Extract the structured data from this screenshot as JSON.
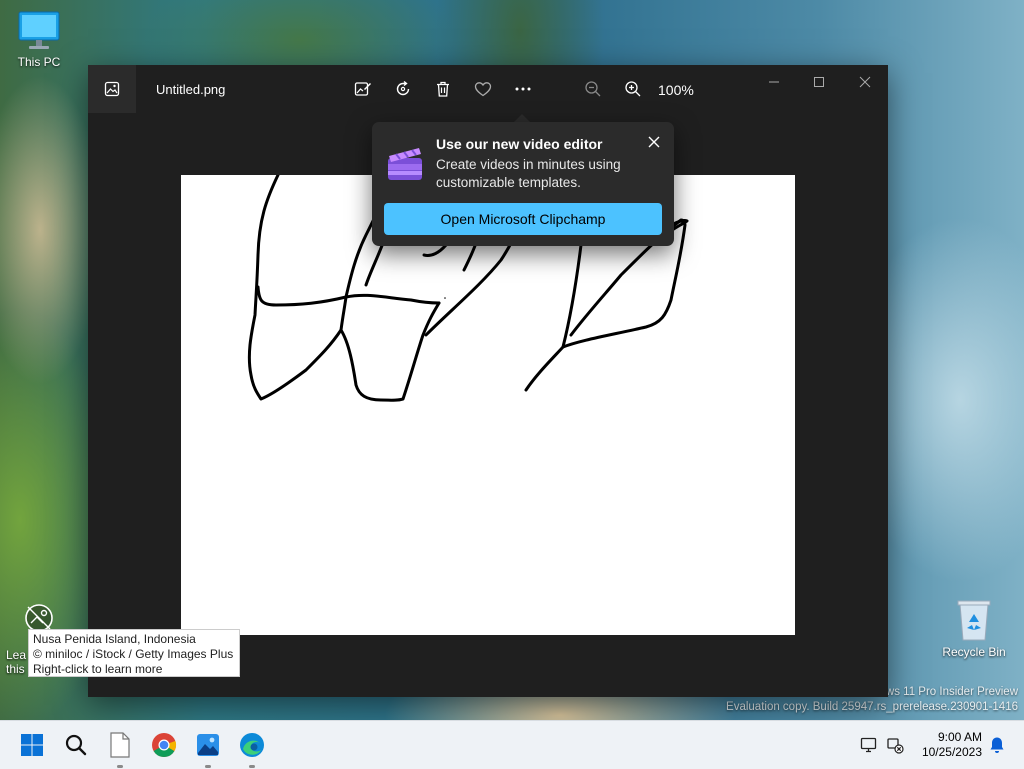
{
  "desktop": {
    "icons": {
      "this_pc": "This PC",
      "recycle_bin": "Recycle Bin"
    },
    "spotlight_label": "Lea\nthis",
    "watermark": {
      "line1": "ws 11 Pro Insider Preview",
      "line2": "Evaluation copy. Build 25947.rs_prerelease.230901-1416"
    }
  },
  "photos_window": {
    "filename": "Untitled.png",
    "zoom": "100%",
    "toolbar": [
      "edit-image-icon",
      "rotate-icon",
      "delete-icon",
      "favorite-icon",
      "more-icon",
      "zoom-out-icon",
      "zoom-in-icon"
    ],
    "window_controls": [
      "minimize-icon",
      "maximize-icon",
      "close-icon"
    ]
  },
  "teaching_tip": {
    "title": "Use our new video editor",
    "body": "Create videos in minutes using customizable templates.",
    "button": "Open Microsoft Clipchamp",
    "accent": "#4cc2ff"
  },
  "spotlight_tooltip": {
    "line1": "Nusa Penida Island, Indonesia",
    "line2": "© miniloc / iStock / Getty Images Plus",
    "line3": "Right-click to learn more"
  },
  "taskbar": {
    "apps": [
      "start-icon",
      "search-icon",
      "notepad-icon",
      "chrome-icon",
      "photos-icon",
      "edge-icon"
    ],
    "time": "9:00 AM",
    "date": "10/25/2023"
  }
}
